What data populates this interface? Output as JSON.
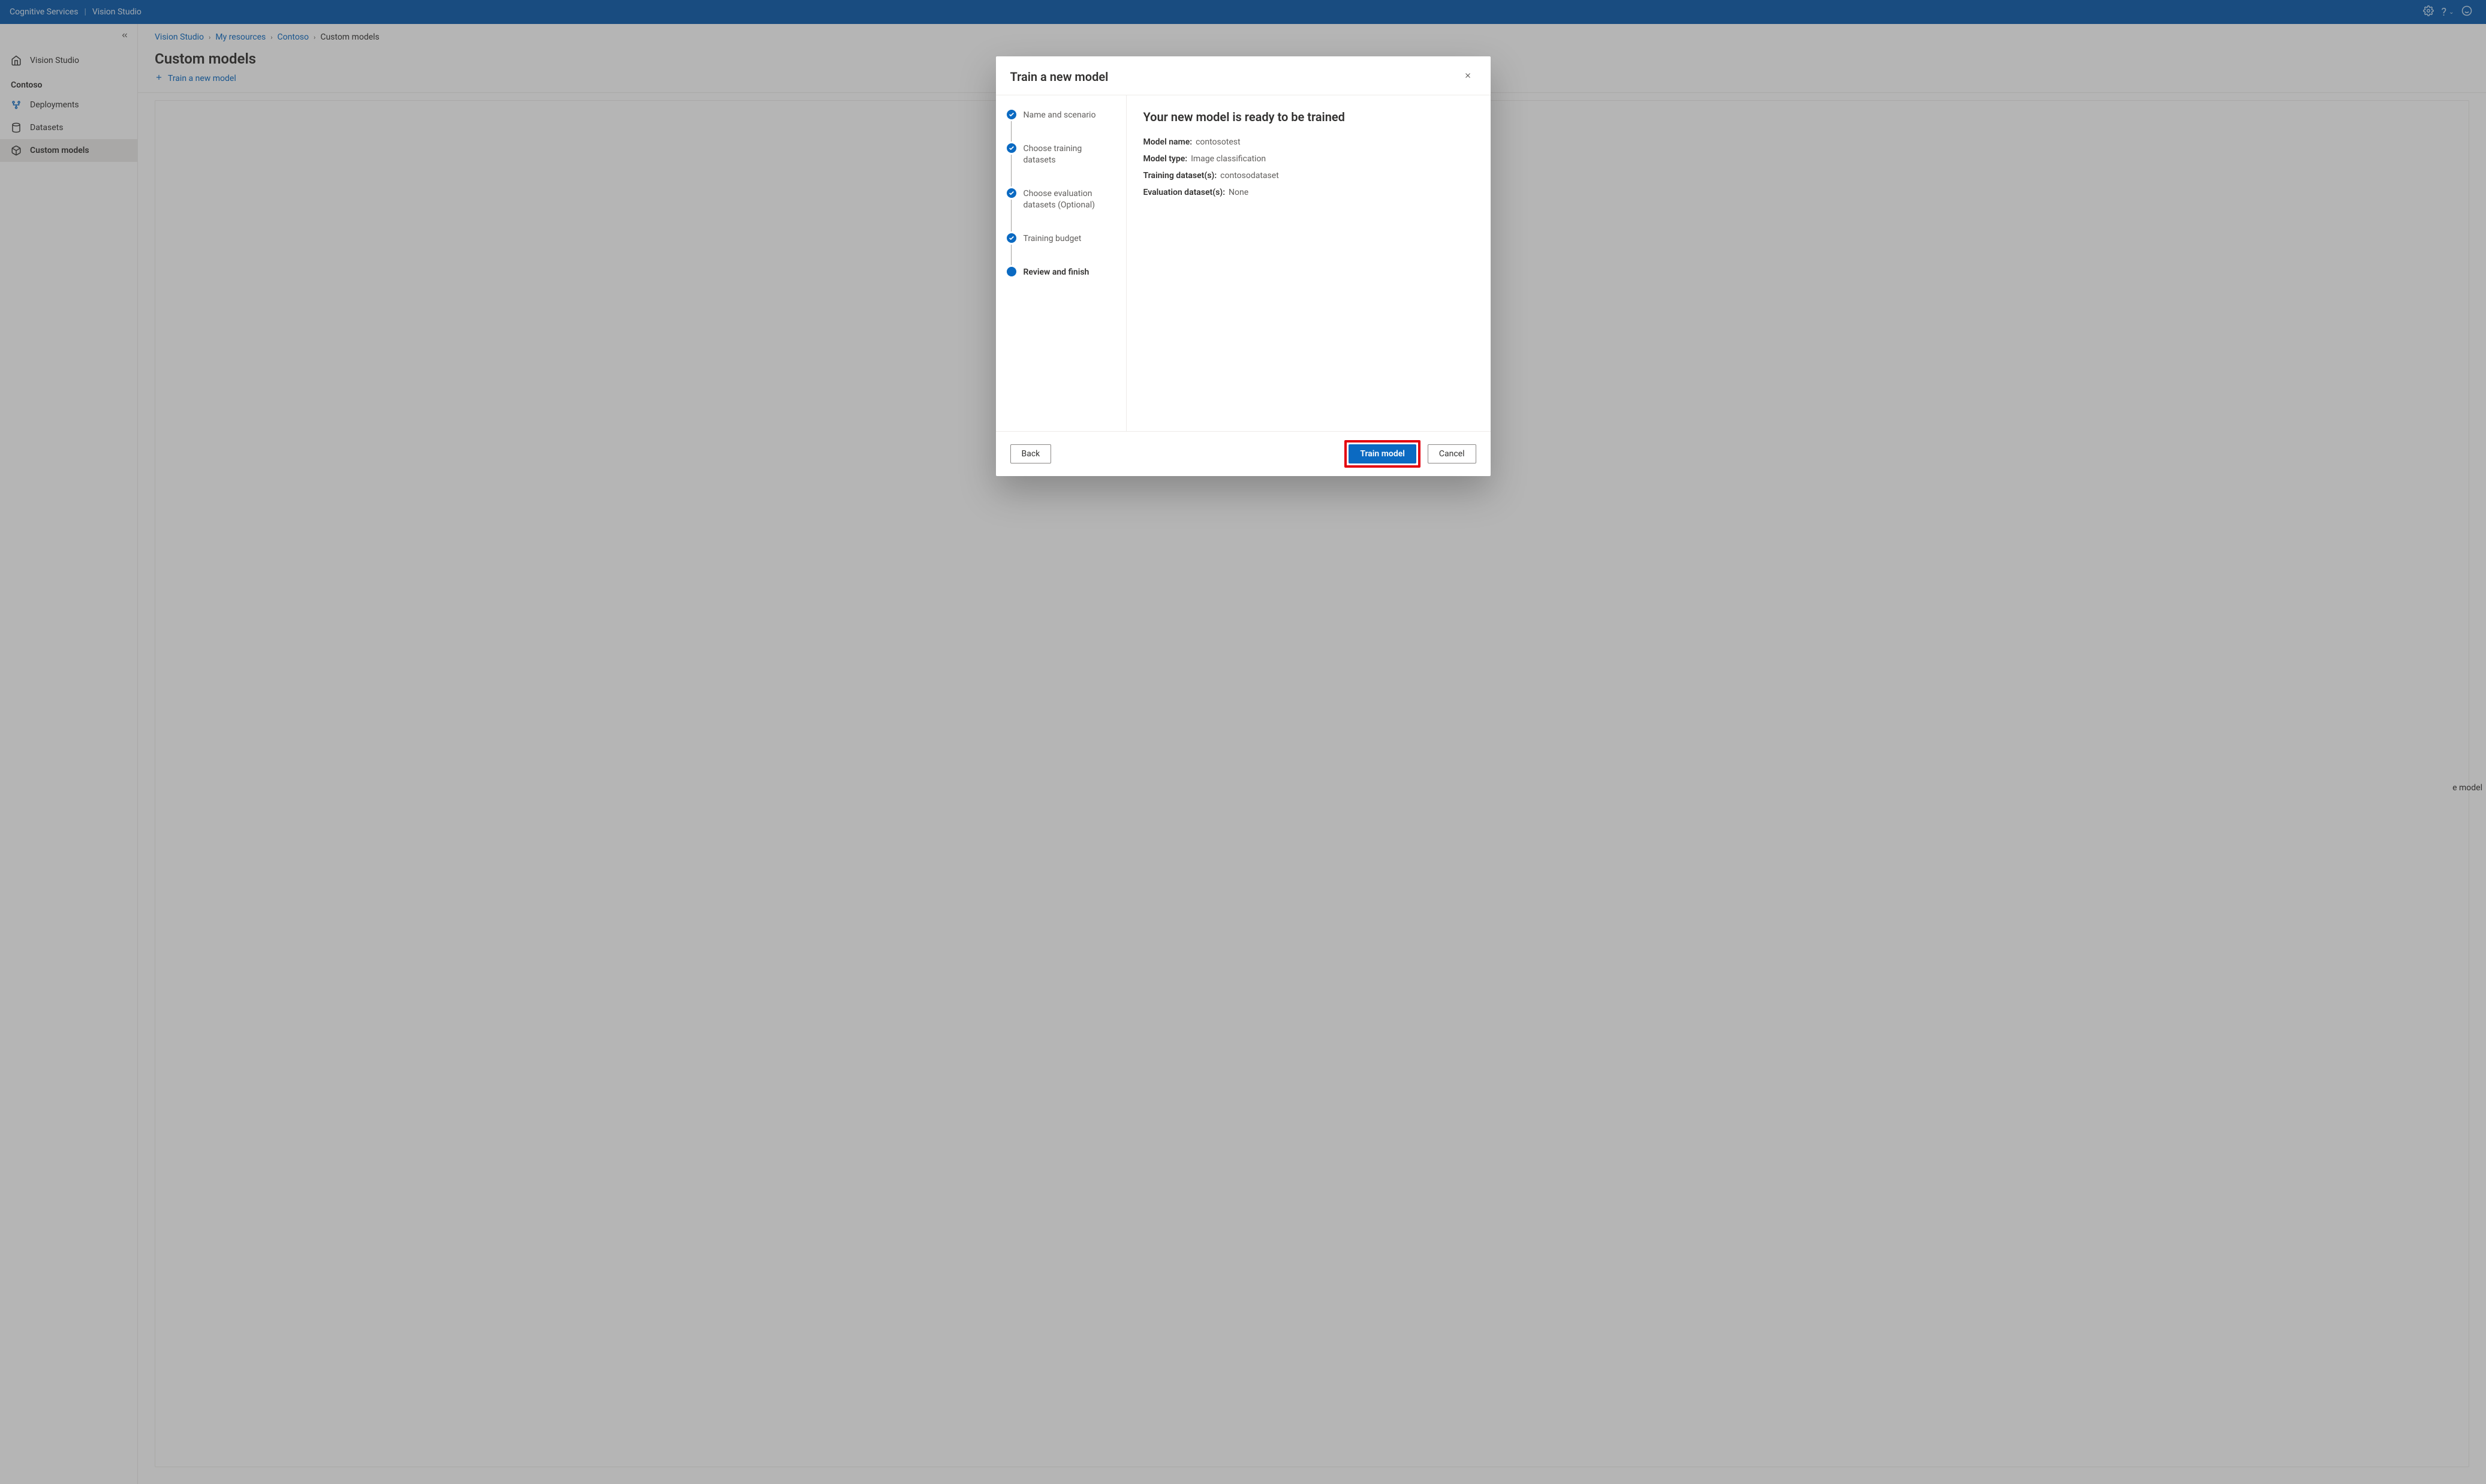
{
  "header": {
    "product": "Cognitive Services",
    "section": "Vision Studio"
  },
  "sidebar": {
    "home_label": "Vision Studio",
    "section_label": "Contoso",
    "items": [
      {
        "label": "Deployments",
        "icon": "deployments"
      },
      {
        "label": "Datasets",
        "icon": "datasets"
      },
      {
        "label": "Custom models",
        "icon": "custom-models",
        "selected": true
      }
    ]
  },
  "breadcrumbs": [
    {
      "label": "Vision Studio"
    },
    {
      "label": "My resources"
    },
    {
      "label": "Contoso"
    },
    {
      "label": "Custom models",
      "current": true
    }
  ],
  "page": {
    "title": "Custom models",
    "toolbar_action": "Train a new model",
    "stray_text": "e model"
  },
  "modal": {
    "title": "Train a new model",
    "steps": [
      {
        "label": "Name and scenario",
        "state": "done"
      },
      {
        "label": "Choose training datasets",
        "state": "done"
      },
      {
        "label": "Choose evaluation datasets (Optional)",
        "state": "done"
      },
      {
        "label": "Training budget",
        "state": "done"
      },
      {
        "label": "Review and finish",
        "state": "current"
      }
    ],
    "content": {
      "heading": "Your new model is ready to be trained",
      "rows": [
        {
          "label": "Model name:",
          "value": "contosotest"
        },
        {
          "label": "Model type:",
          "value": "Image classification"
        },
        {
          "label": "Training dataset(s):",
          "value": "contosodataset"
        },
        {
          "label": "Evaluation dataset(s):",
          "value": "None"
        }
      ]
    },
    "buttons": {
      "back": "Back",
      "primary": "Train model",
      "cancel": "Cancel"
    }
  }
}
